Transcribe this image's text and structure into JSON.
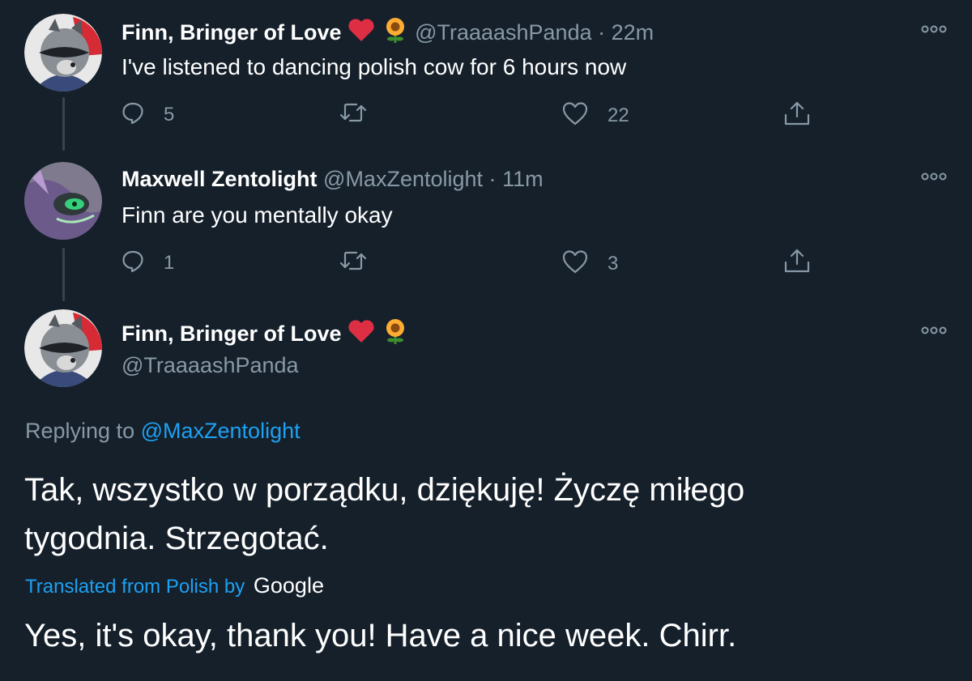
{
  "tweets": [
    {
      "display_name": "Finn, Bringer of Love",
      "handle": "@TraaaashPanda",
      "separator": "·",
      "time": "22m",
      "text": "I've listened to dancing polish cow for 6 hours now",
      "reply_count": "5",
      "retweet_count": "",
      "like_count": "22"
    },
    {
      "display_name": "Maxwell Zentolight",
      "handle": "@MaxZentolight",
      "separator": "·",
      "time": "11m",
      "text": "Finn are you mentally okay",
      "reply_count": "1",
      "retweet_count": "",
      "like_count": "3"
    }
  ],
  "main_tweet": {
    "display_name": "Finn, Bringer of Love",
    "handle": "@TraaaashPanda",
    "replying_to_prefix": "Replying to",
    "replying_to_handle": "@MaxZentolight",
    "text_line1": "Tak, wszystko w porządku, dziękuję! Życzę miłego",
    "text_line2": "tygodnia. Strzegotać.",
    "translated_label": "Translated from Polish by",
    "translation_provider": "Google",
    "translation": "Yes, it's okay, thank you! Have a nice week. Chirr."
  },
  "colors": {
    "background": "#15202b",
    "muted": "#8899a6",
    "link": "#1da1f2",
    "thread_line": "#38444d"
  },
  "icons": [
    "more-icon",
    "reply-icon",
    "retweet-icon",
    "like-icon",
    "share-icon",
    "heart-emoji",
    "sunflower-emoji"
  ]
}
